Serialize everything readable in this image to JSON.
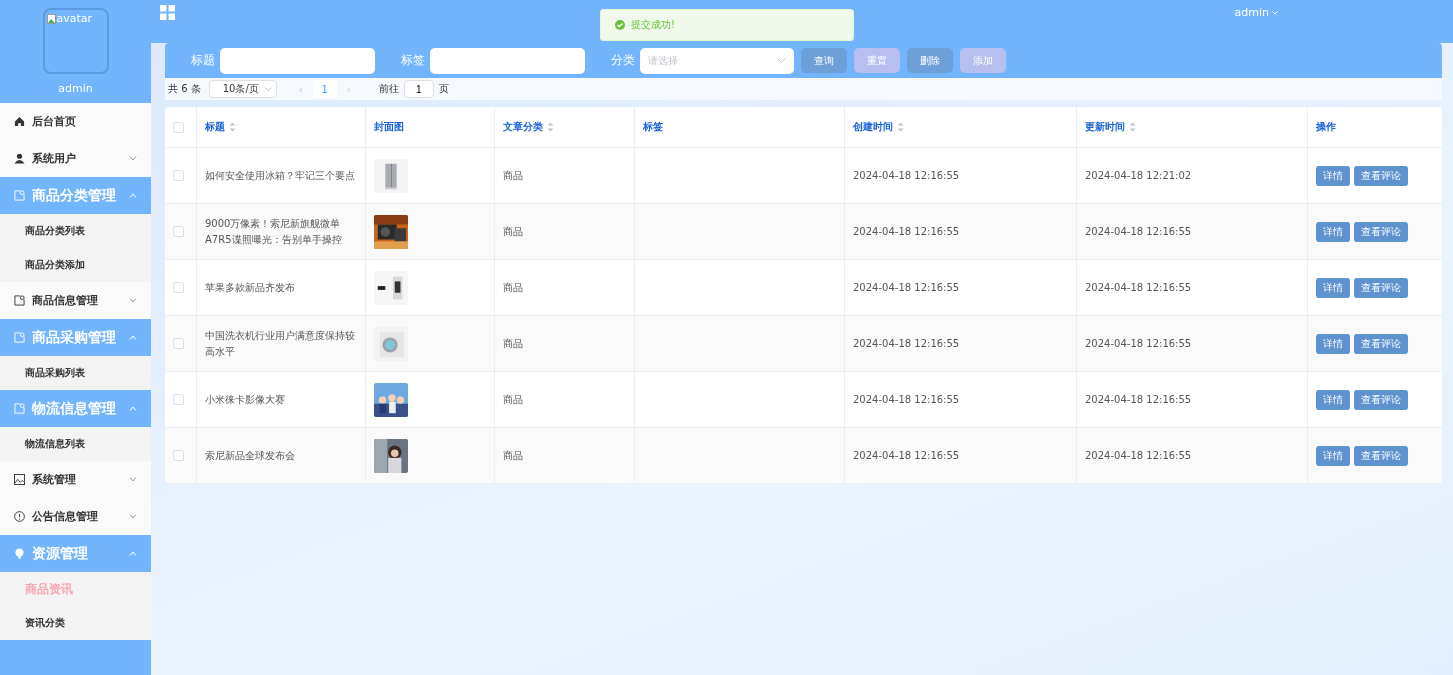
{
  "sidebar": {
    "avatar_alt": "avatar",
    "username": "admin",
    "menu": [
      {
        "kind": "link",
        "label": "后台首页"
      },
      {
        "kind": "submenu",
        "label": "系统用户",
        "expanded": false
      },
      {
        "kind": "submenu",
        "label": "商品分类管理",
        "expanded": true,
        "children": [
          {
            "label": "商品分类列表",
            "selected": false
          },
          {
            "label": "商品分类添加",
            "selected": false
          }
        ]
      },
      {
        "kind": "submenu",
        "label": "商品信息管理",
        "expanded": false
      },
      {
        "kind": "submenu",
        "label": "商品采购管理",
        "expanded": true,
        "children": [
          {
            "label": "商品采购列表",
            "selected": false
          }
        ]
      },
      {
        "kind": "submenu",
        "label": "物流信息管理",
        "expanded": true,
        "children": [
          {
            "label": "物流信息列表",
            "selected": false
          }
        ]
      },
      {
        "kind": "submenu",
        "label": "系统管理",
        "expanded": false
      },
      {
        "kind": "submenu",
        "label": "公告信息管理",
        "expanded": false
      },
      {
        "kind": "submenu",
        "label": "资源管理",
        "expanded": true,
        "children": [
          {
            "label": "商品资讯",
            "selected": true
          },
          {
            "label": "资讯分类",
            "selected": false
          }
        ]
      }
    ]
  },
  "header": {
    "user": "admin"
  },
  "toast": {
    "message": "提交成功!"
  },
  "search": {
    "fields": [
      {
        "label": "标题",
        "kind": "text"
      },
      {
        "label": "标签",
        "kind": "text"
      },
      {
        "label": "分类",
        "kind": "select",
        "placeholder": "请选择"
      }
    ],
    "buttons": [
      {
        "label": "查询",
        "kind": "primary"
      },
      {
        "label": "重置",
        "kind": "light"
      },
      {
        "label": "删除",
        "kind": "primary"
      },
      {
        "label": "添加",
        "kind": "light"
      }
    ]
  },
  "pagination": {
    "total": "共 6 条",
    "page_size": "10条/页",
    "prev": "‹",
    "current": "1",
    "next": "›",
    "goto_label": "前往",
    "goto_value": "1",
    "goto_suffix": "页"
  },
  "table": {
    "select_all": false,
    "columns": [
      {
        "label": "标题",
        "sortable": true
      },
      {
        "label": "封面图",
        "sortable": false
      },
      {
        "label": "文章分类",
        "sortable": true
      },
      {
        "label": "标签",
        "sortable": false
      },
      {
        "label": "创建时间",
        "sortable": true
      },
      {
        "label": "更新时间",
        "sortable": true
      },
      {
        "label": "操作",
        "sortable": false
      }
    ],
    "rows": [
      {
        "selected": false,
        "title": "如何安全使用冰箱？牢记三个要点",
        "cover": {
          "kind": "picture"
        },
        "category": "商品",
        "created": "2024-04-18 12:16:55",
        "updated": "2024-04-18 12:21:02",
        "actions": [
          "详情",
          "查看评论"
        ]
      },
      {
        "selected": false,
        "title": "9000万像素！索尼新旗舰微单A7R5谍照曝光：告别单手操控",
        "cover": {
          "kind": "picture"
        },
        "category": "商品",
        "created": "2024-04-18 12:16:55",
        "updated": "2024-04-18 12:16:55",
        "actions": [
          "详情",
          "查看评论"
        ]
      },
      {
        "selected": false,
        "title": "苹果多款新品齐发布",
        "cover": {
          "kind": "picture"
        },
        "category": "商品",
        "created": "2024-04-18 12:16:55",
        "updated": "2024-04-18 12:16:55",
        "actions": [
          "详情",
          "查看评论"
        ]
      },
      {
        "selected": false,
        "title": "中国洗衣机行业用户满意度保持较高水平",
        "cover": {
          "kind": "picture"
        },
        "category": "商品",
        "created": "2024-04-18 12:16:55",
        "updated": "2024-04-18 12:16:55",
        "actions": [
          "详情",
          "查看评论"
        ]
      },
      {
        "selected": false,
        "title": "小米徕卡影像大赛",
        "cover": {
          "kind": "picture"
        },
        "category": "商品",
        "created": "2024-04-18 12:16:55",
        "updated": "2024-04-18 12:16:55",
        "actions": [
          "详情",
          "查看评论"
        ]
      },
      {
        "selected": false,
        "title": "索尼新品全球发布会",
        "cover": {
          "kind": "picture"
        },
        "category": "商品",
        "created": "2024-04-18 12:16:55",
        "updated": "2024-04-18 12:16:55",
        "actions": [
          "详情",
          "查看评论"
        ]
      }
    ]
  }
}
